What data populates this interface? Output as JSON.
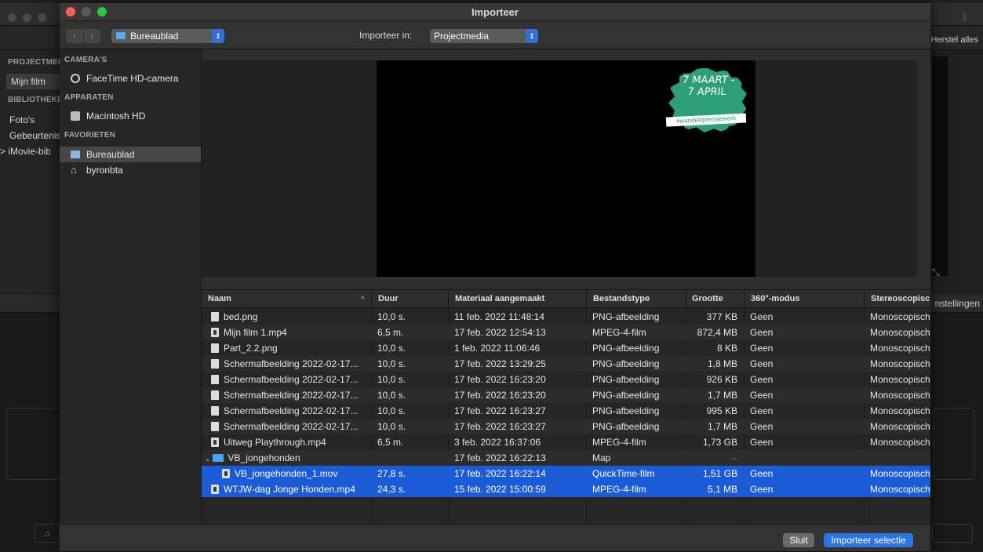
{
  "background_app": {
    "restore_all": "Herstel alles",
    "settings": "nstellingen",
    "sidebar": {
      "section_project": "PROJECTMEDIA",
      "item_project": "Mijn film",
      "section_library": "BIBLIOTHEKEN",
      "item_photos": "Foto's",
      "item_events": "Gebeurtenissen",
      "item_imovie": "> iMovie-bibliotheek"
    }
  },
  "dialog": {
    "title": "Importeer",
    "location_popup": "Bureaublad",
    "import_in_label": "Importeer in:",
    "import_in_popup": "Projectmedia",
    "sidebar": {
      "sections": [
        {
          "label": "CAMERA'S",
          "items": [
            {
              "label": "FaceTime HD-camera",
              "icon": "camera-icon"
            }
          ]
        },
        {
          "label": "APPARATEN",
          "items": [
            {
              "label": "Macintosh HD",
              "icon": "disk-icon"
            }
          ]
        },
        {
          "label": "FAVORIETEN",
          "items": [
            {
              "label": "Bureaublad",
              "icon": "desktop-folder-icon",
              "selected": true
            },
            {
              "label": "byronbta",
              "icon": "home-icon"
            }
          ]
        }
      ]
    },
    "preview": {
      "badge_line1": "7 MAART -",
      "badge_line2": "7 APRIL",
      "badge_tag": "#wandeltijdensjewerk"
    },
    "columns": [
      "Naam",
      "Duur",
      "Materiaal aangemaakt",
      "Bestandstype",
      "Grootte",
      "360°-modus",
      "Stereoscopische"
    ],
    "rows": [
      {
        "name": "bed.png",
        "duration": "10,0 s.",
        "created": "11 feb. 2022 11:48:14",
        "type": "PNG-afbeelding",
        "size": "377 KB",
        "mode360": "Geen",
        "stereo": "Monoscopisch",
        "icon": "image"
      },
      {
        "name": "Mijn film 1.mp4",
        "duration": "6,5 m.",
        "created": "17 feb. 2022 12:54:13",
        "type": "MPEG-4-film",
        "size": "872,4 MB",
        "mode360": "Geen",
        "stereo": "Monoscopisch",
        "icon": "video"
      },
      {
        "name": "Part_2.2.png",
        "duration": "10,0 s.",
        "created": "1 feb. 2022 11:06:46",
        "type": "PNG-afbeelding",
        "size": "8 KB",
        "mode360": "Geen",
        "stereo": "Monoscopisch",
        "icon": "image"
      },
      {
        "name": "Schermafbeelding 2022-02-17...",
        "duration": "10,0 s.",
        "created": "17 feb. 2022 13:29:25",
        "type": "PNG-afbeelding",
        "size": "1,8 MB",
        "mode360": "Geen",
        "stereo": "Monoscopisch",
        "icon": "image"
      },
      {
        "name": "Schermafbeelding 2022-02-17...",
        "duration": "10,0 s.",
        "created": "17 feb. 2022 16:23:20",
        "type": "PNG-afbeelding",
        "size": "926 KB",
        "mode360": "Geen",
        "stereo": "Monoscopisch",
        "icon": "image"
      },
      {
        "name": "Schermafbeelding 2022-02-17...",
        "duration": "10,0 s.",
        "created": "17 feb. 2022 16:23:20",
        "type": "PNG-afbeelding",
        "size": "1,7 MB",
        "mode360": "Geen",
        "stereo": "Monoscopisch",
        "icon": "image"
      },
      {
        "name": "Schermafbeelding 2022-02-17...",
        "duration": "10,0 s.",
        "created": "17 feb. 2022 16:23:27",
        "type": "PNG-afbeelding",
        "size": "995 KB",
        "mode360": "Geen",
        "stereo": "Monoscopisch",
        "icon": "image"
      },
      {
        "name": "Schermafbeelding 2022-02-17...",
        "duration": "10,0 s.",
        "created": "17 feb. 2022 16:23:27",
        "type": "PNG-afbeelding",
        "size": "1,7 MB",
        "mode360": "Geen",
        "stereo": "Monoscopisch",
        "icon": "image"
      },
      {
        "name": "Uitweg Playthrough.mp4",
        "duration": "6,5 m.",
        "created": "3 feb. 2022 16:37:06",
        "type": "MPEG-4-film",
        "size": "1,73 GB",
        "mode360": "Geen",
        "stereo": "Monoscopisch",
        "icon": "video"
      },
      {
        "name": "VB_jongehonden",
        "duration": "",
        "created": "17 feb. 2022 16:22:13",
        "type": "Map",
        "size": "--",
        "mode360": "",
        "stereo": "",
        "icon": "folder"
      },
      {
        "name": "VB_jongehonden_1.mov",
        "duration": "27,8 s.",
        "created": "17 feb. 2022 16:22:14",
        "type": "QuickTime-film",
        "size": "1,51 GB",
        "mode360": "Geen",
        "stereo": "Monoscopisch",
        "icon": "video",
        "selected": true,
        "indent": true
      },
      {
        "name": "WTJW-dag Jonge Honden.mp4",
        "duration": "24,3 s.",
        "created": "15 feb. 2022 15:00:59",
        "type": "MPEG-4-film",
        "size": "5,1 MB",
        "mode360": "Geen",
        "stereo": "Monoscopisch",
        "icon": "video",
        "selected": true
      }
    ],
    "close_button": "Sluit",
    "import_button": "Importeer selectie"
  }
}
